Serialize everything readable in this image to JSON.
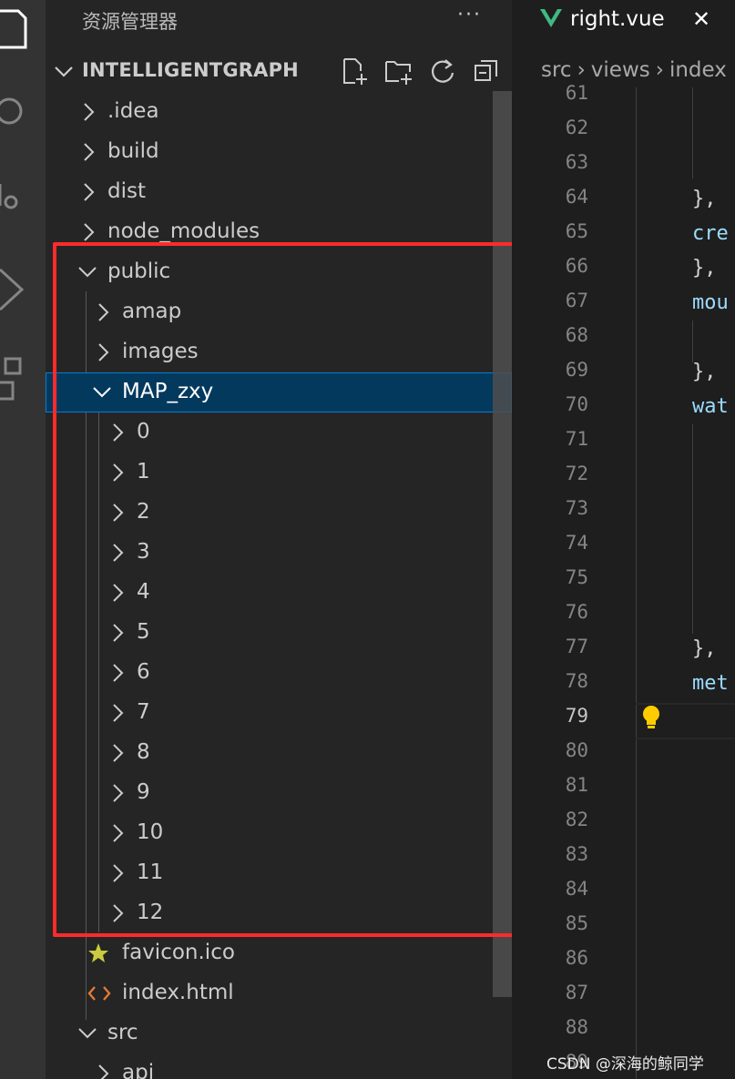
{
  "sidebar": {
    "title": "资源管理器",
    "more_label": "···",
    "workspace": "INTELLIGENTGRAPH",
    "tree": [
      {
        "label": ".idea",
        "expanded": false
      },
      {
        "label": "build",
        "expanded": false
      },
      {
        "label": "dist",
        "expanded": false
      },
      {
        "label": "node_modules",
        "expanded": false
      },
      {
        "label": "public",
        "expanded": true
      },
      {
        "label": "amap",
        "expanded": false
      },
      {
        "label": "images",
        "expanded": false
      },
      {
        "label": "MAP_zxy",
        "expanded": true,
        "selected": true
      },
      {
        "label": "0",
        "expanded": false
      },
      {
        "label": "1",
        "expanded": false
      },
      {
        "label": "2",
        "expanded": false
      },
      {
        "label": "3",
        "expanded": false
      },
      {
        "label": "4",
        "expanded": false
      },
      {
        "label": "5",
        "expanded": false
      },
      {
        "label": "6",
        "expanded": false
      },
      {
        "label": "7",
        "expanded": false
      },
      {
        "label": "8",
        "expanded": false
      },
      {
        "label": "9",
        "expanded": false
      },
      {
        "label": "10",
        "expanded": false
      },
      {
        "label": "11",
        "expanded": false
      },
      {
        "label": "12",
        "expanded": false
      },
      {
        "label": "favicon.ico",
        "icon": "star-icon"
      },
      {
        "label": "index.html",
        "icon": "code-icon"
      },
      {
        "label": "src",
        "expanded": true
      },
      {
        "label": "api",
        "expanded": false
      }
    ]
  },
  "editor": {
    "tab_label": "right.vue",
    "breadcrumb": [
      "src",
      "views",
      "index"
    ],
    "line_numbers": [
      "61",
      "62",
      "63",
      "64",
      "65",
      "66",
      "67",
      "68",
      "69",
      "70",
      "71",
      "72",
      "73",
      "74",
      "75",
      "76",
      "77",
      "78",
      "79",
      "80",
      "81",
      "82",
      "83",
      "84",
      "85",
      "86",
      "87",
      "88",
      "89"
    ],
    "current_line": "79",
    "code": {
      "64": "},",
      "65": "cre",
      "66": "},",
      "67": "mou",
      "69": "},",
      "70": "wat",
      "77": "},",
      "78": "met"
    }
  },
  "watermark": "CSDN @深海的鲸同学",
  "colors": {
    "accent": "#007fd4",
    "selection": "#04395e",
    "highlight_box": "#ff2b2b",
    "vue_green": "#41b883",
    "bulb": "#ffcc00"
  }
}
